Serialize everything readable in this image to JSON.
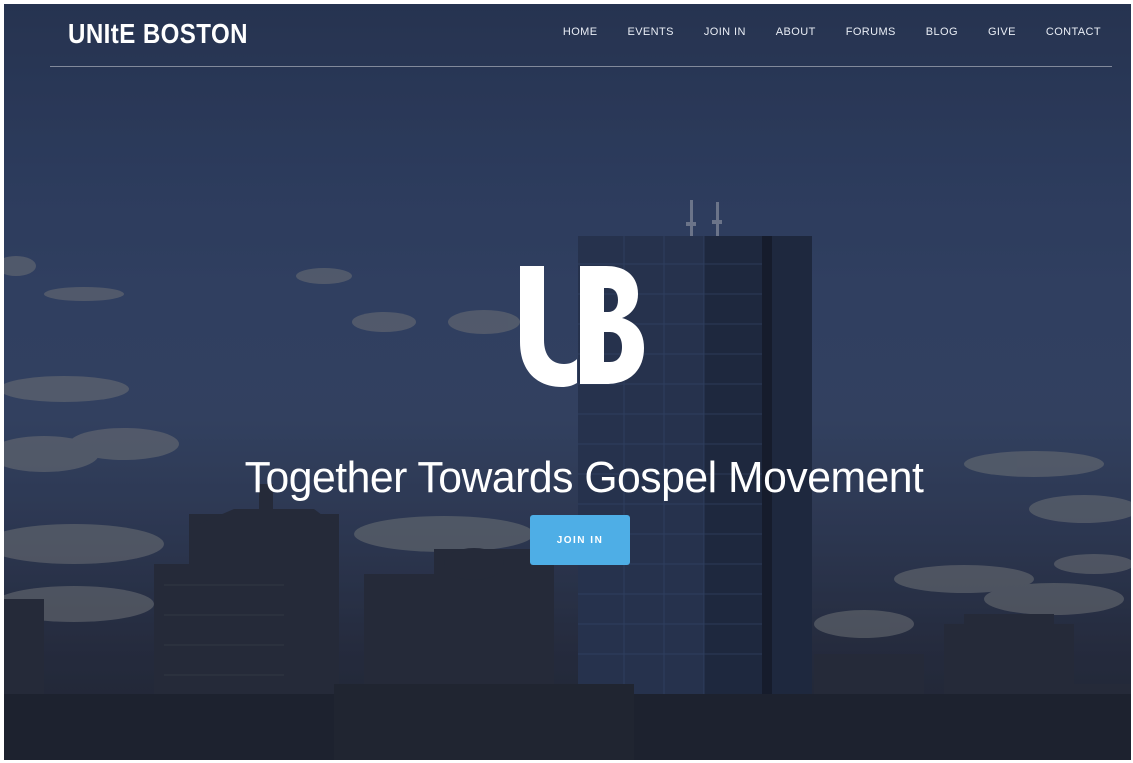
{
  "brand": {
    "title": "UNItE BOSTON"
  },
  "nav": {
    "items": [
      {
        "label": "HOME"
      },
      {
        "label": "EVENTS"
      },
      {
        "label": "JOIN IN"
      },
      {
        "label": "ABOUT"
      },
      {
        "label": "FORUMS"
      },
      {
        "label": "BLOG"
      },
      {
        "label": "GIVE"
      },
      {
        "label": "CONTACT"
      }
    ]
  },
  "hero": {
    "logo_text": "UB",
    "tagline": "Together Towards Gospel Movement",
    "cta_label": "JOIN IN"
  },
  "colors": {
    "accent": "#4eaee6",
    "sky": "#34466a",
    "text": "#ffffff"
  }
}
